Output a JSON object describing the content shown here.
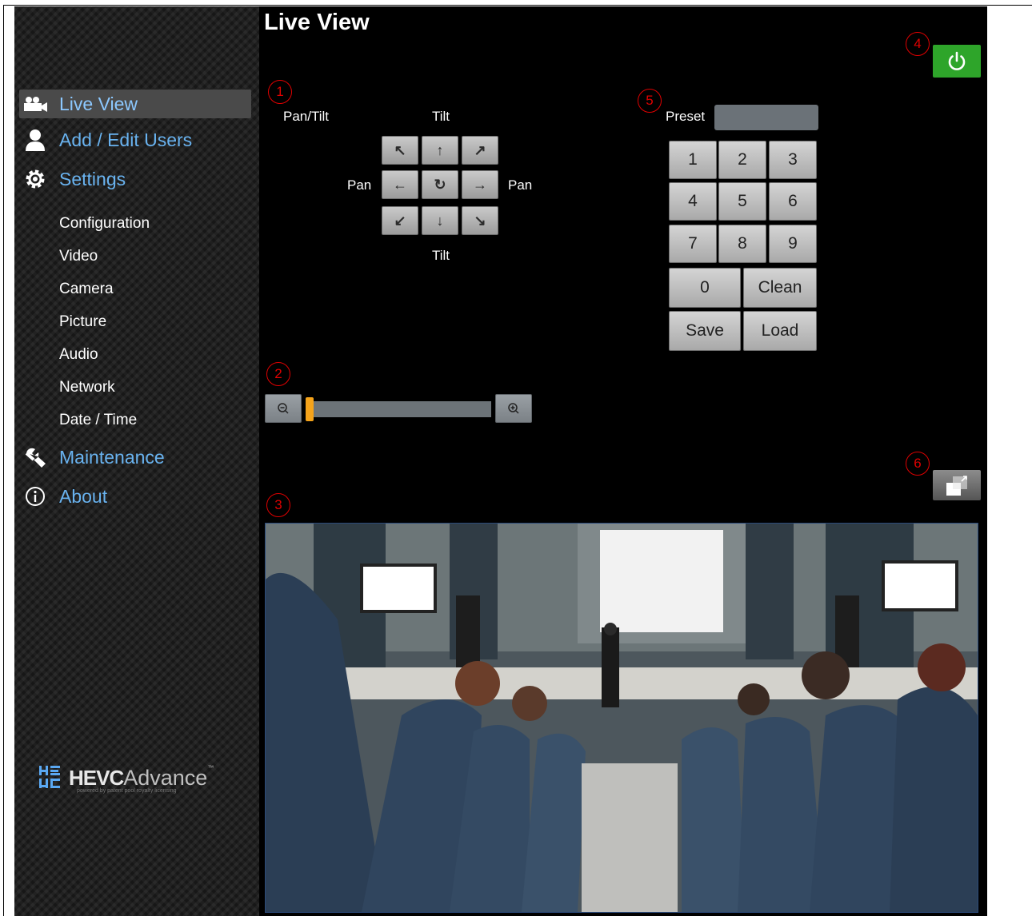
{
  "title": "Live View",
  "sidebar": {
    "nav": [
      {
        "label": "Live View",
        "icon": "video-camera-icon",
        "active": true
      },
      {
        "label": "Add / Edit Users",
        "icon": "user-icon"
      },
      {
        "label": "Settings",
        "icon": "gear-icon"
      },
      {
        "label": "Maintenance",
        "icon": "wrench-icon"
      },
      {
        "label": "About",
        "icon": "info-icon"
      }
    ],
    "settings_sub": [
      "Configuration",
      "Video",
      "Camera",
      "Picture",
      "Audio",
      "Network",
      "Date / Time"
    ],
    "logo": {
      "mark": "HE VC",
      "brand": "HEVC",
      "brand_tail": "Advance",
      "tm": "™",
      "tagline": "powered by patent pool royalty licensing"
    }
  },
  "markers": [
    "1",
    "2",
    "3",
    "4",
    "5",
    "6"
  ],
  "ptz": {
    "pan_tilt_label": "Pan/Tilt",
    "tilt_top": "Tilt",
    "tilt_bottom": "Tilt",
    "pan_left": "Pan",
    "pan_right": "Pan",
    "buttons": [
      "↖",
      "↑",
      "↗",
      "←",
      "↻",
      "→",
      "↙",
      "↓",
      "↘"
    ]
  },
  "preset": {
    "label": "Preset",
    "value": "",
    "keys": [
      "1",
      "2",
      "3",
      "4",
      "5",
      "6",
      "7",
      "8",
      "9"
    ],
    "zero": "0",
    "clean": "Clean",
    "save": "Save",
    "load": "Load"
  },
  "zoom": {
    "level": 0
  },
  "colors": {
    "accent_nav": "#69b3f0",
    "power": "#2ea52a",
    "zoom_thumb": "#f5a31a",
    "marker": "#e00000"
  }
}
